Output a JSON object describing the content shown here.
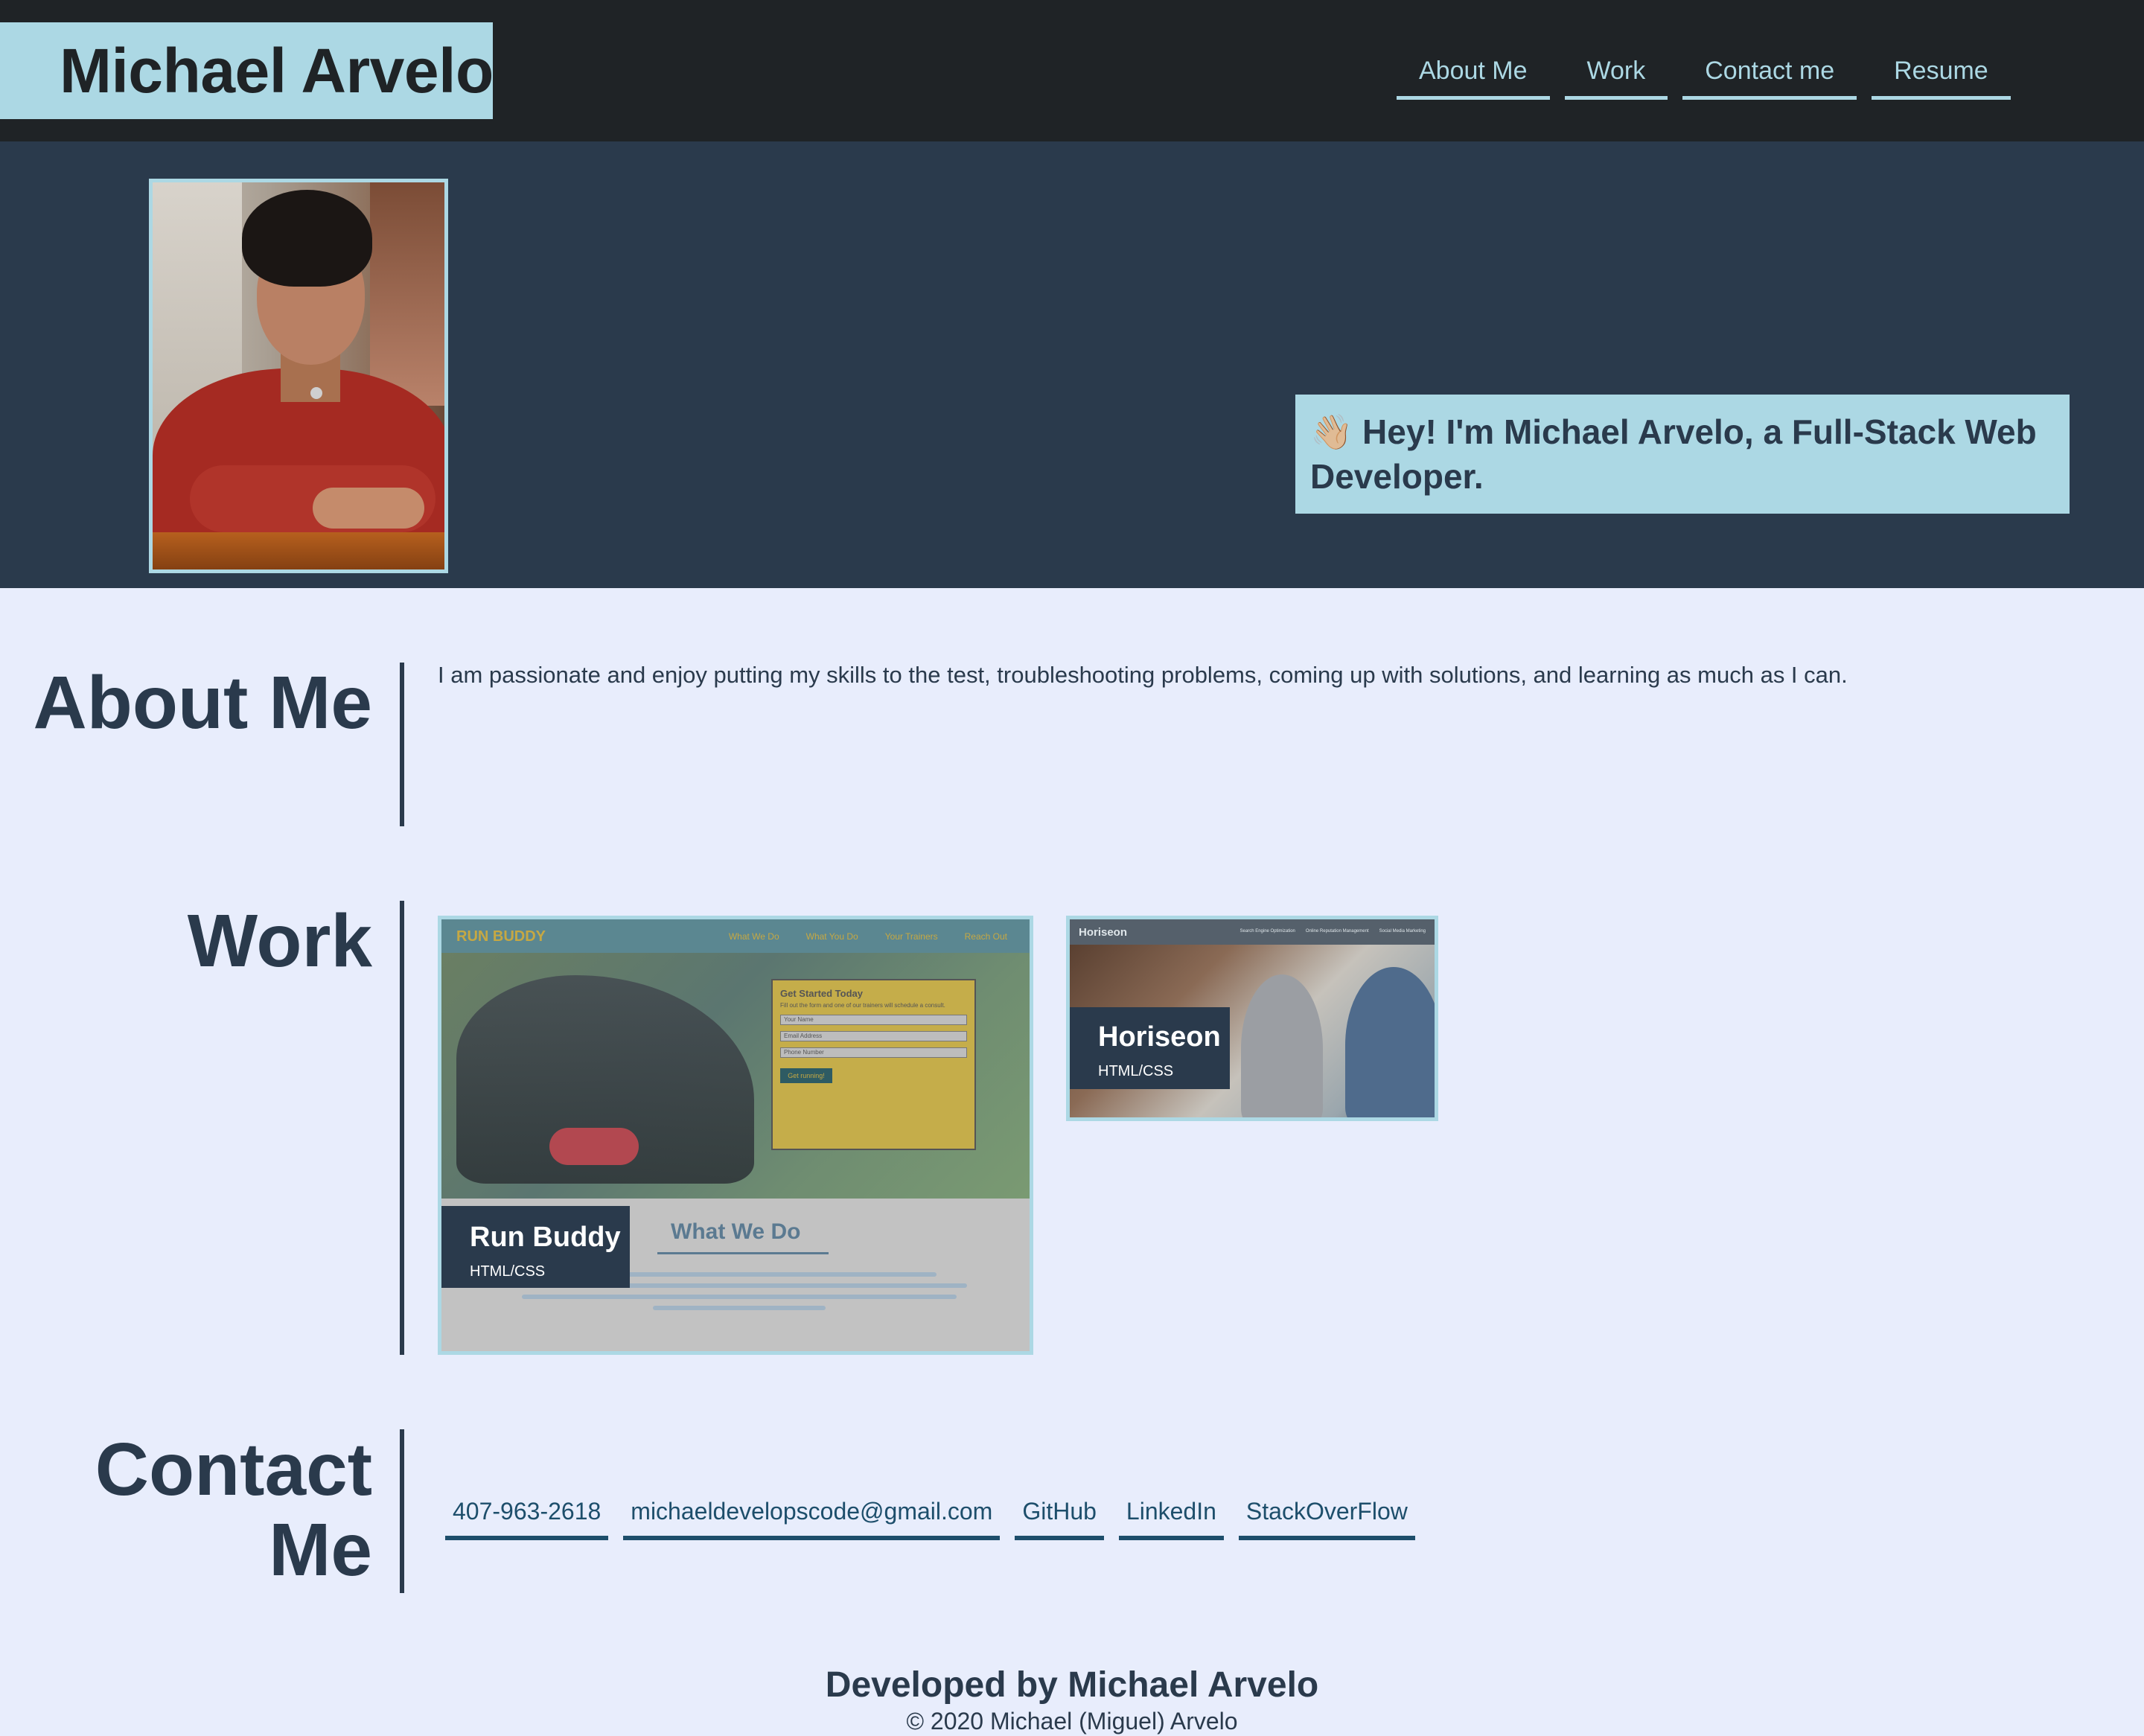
{
  "header": {
    "brand": "Michael Arvelo",
    "nav": [
      "About Me",
      "Work",
      "Contact me",
      "Resume"
    ]
  },
  "hero": {
    "greeting": "👋🏼 Hey! I'm Michael Arvelo, a Full-Stack Web Developer."
  },
  "about": {
    "title": "About Me",
    "text": "I am passionate and enjoy putting my skills to the test, troubleshooting problems, coming up with solutions, and learning as much as I can."
  },
  "work": {
    "title": "Work",
    "projects": [
      {
        "name": "Run Buddy",
        "tech": "HTML/CSS",
        "preview": {
          "logo": "RUN BUDDY",
          "nav": [
            "What We Do",
            "What You Do",
            "Your Trainers",
            "Reach Out"
          ],
          "form_title": "Get Started Today",
          "form_subtitle": "Fill out the form and one of our trainers will schedule a consult.",
          "fields": [
            "Your Name",
            "Email Address",
            "Phone Number"
          ],
          "button": "Get running!",
          "section_title": "What We Do"
        }
      },
      {
        "name": "Horiseon",
        "tech": "HTML/CSS",
        "preview": {
          "logo": "Horiseon",
          "nav": [
            "Search Engine Optimization",
            "Online Reputation Management",
            "Social Media Marketing"
          ]
        }
      }
    ]
  },
  "contact": {
    "title": "Contact Me",
    "links": [
      "407-963-2618",
      "michaeldevelopscode@gmail.com",
      "GitHub",
      "LinkedIn",
      "StackOverFlow"
    ]
  },
  "footer": {
    "title": "Developed by Michael Arvelo",
    "copyright": "© 2020 Michael (Miguel) Arvelo"
  },
  "colors": {
    "header_bg": "#1f2326",
    "hero_bg": "#2a3a4c",
    "accent": "#acd8e4",
    "page_bg": "#e8edfc",
    "link": "#1d4e6b"
  }
}
